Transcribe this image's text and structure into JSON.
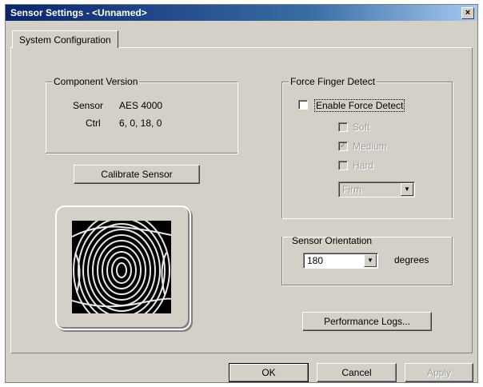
{
  "window": {
    "title": "Sensor Settings - <Unnamed>",
    "close_label": "×"
  },
  "tabs": [
    {
      "label": "System Configuration"
    }
  ],
  "component_version": {
    "title": "Component Version",
    "rows": [
      {
        "label": "Sensor",
        "value": "AES 4000"
      },
      {
        "label": "Ctrl",
        "value": "6, 0, 18, 0"
      }
    ]
  },
  "calibrate_button": "Calibrate Sensor",
  "force_finger": {
    "title": "Force Finger Detect",
    "enable_label": "Enable Force Detect",
    "enable_checked": false,
    "options": [
      {
        "label": "Soft",
        "checked": false
      },
      {
        "label": "Medium",
        "checked": true
      },
      {
        "label": "Hard",
        "checked": false
      }
    ],
    "select_value": "Firm"
  },
  "orientation": {
    "title": "Sensor Orientation",
    "value": "180",
    "unit": "degrees"
  },
  "performance_logs_button": "Performance Logs...",
  "footer": {
    "ok": "OK",
    "cancel": "Cancel",
    "apply": "Apply"
  },
  "colors": {
    "titlebar_start": "#0a246a",
    "titlebar_end": "#a6caf0",
    "face": "#d4d0c8"
  }
}
